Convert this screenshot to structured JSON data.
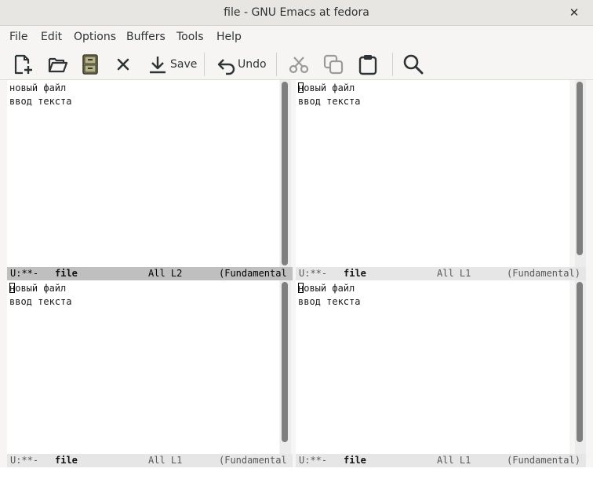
{
  "window": {
    "title": "file - GNU Emacs at fedora",
    "close_glyph": "✕"
  },
  "menu": {
    "items": [
      "File",
      "Edit",
      "Options",
      "Buffers",
      "Tools",
      "Help"
    ]
  },
  "toolbar": {
    "save_label": "Save",
    "undo_label": "Undo",
    "icons": [
      "new-file-icon",
      "open-folder-icon",
      "dired-cabinet-icon",
      "close-icon",
      "save-icon",
      "undo-icon",
      "cut-icon",
      "copy-icon",
      "paste-icon",
      "search-icon"
    ]
  },
  "windows": [
    {
      "lines": [
        "новый файл",
        "ввод текста"
      ],
      "cursor_at_start": false,
      "modeline": {
        "status": "U:**-",
        "buffer": "file",
        "position": "All L2",
        "mode": "(Fundamental"
      },
      "active": true
    },
    {
      "lines": [
        "новый файл",
        "ввод текста"
      ],
      "cursor_at_start": true,
      "modeline": {
        "status": "U:**-",
        "buffer": "file",
        "position": "All L1",
        "mode": "(Fundamental)"
      },
      "active": false
    },
    {
      "lines": [
        "новый файл",
        "ввод текста"
      ],
      "cursor_at_start": true,
      "modeline": {
        "status": "U:**-",
        "buffer": "file",
        "position": "All L1",
        "mode": "(Fundamental"
      },
      "active": false
    },
    {
      "lines": [
        "новый файл",
        "ввод текста"
      ],
      "cursor_at_start": true,
      "modeline": {
        "status": "U:**-",
        "buffer": "file",
        "position": "All L1",
        "mode": "(Fundamental)"
      },
      "active": false
    }
  ],
  "colors": {
    "titlebar": "#e8e6e3",
    "active_modeline": "#bfbfbf",
    "inactive_modeline": "#e6e6e6",
    "scroll_thumb": "#7f7f7f"
  }
}
